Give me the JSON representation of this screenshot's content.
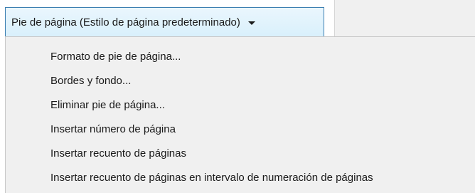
{
  "header_button": {
    "label": "Pie de página (Estilo de página predeterminado)",
    "icon": "chevron-down-icon"
  },
  "menu": {
    "items": [
      {
        "label": "Formato de pie de página..."
      },
      {
        "label": "Bordes y fondo..."
      },
      {
        "label": "Eliminar pie de página..."
      },
      {
        "label": "Insertar número de página"
      },
      {
        "label": "Insertar recuento de páginas"
      },
      {
        "label": "Insertar recuento de páginas en intervalo de numeración de páginas"
      }
    ]
  }
}
